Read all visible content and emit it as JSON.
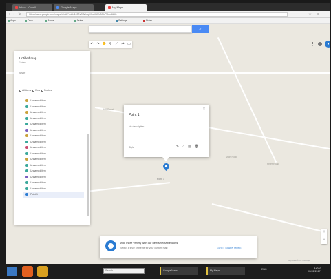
{
  "browser": {
    "tabs": [
      {
        "label": "Inbox - Gmail"
      },
      {
        "label": "Google Maps"
      },
      {
        "label": "My Maps"
      }
    ],
    "url": "https://www.google.com/maps/d/edit?mid=1z0ZsC4Wxq9KpuJ0fZq0GbPRmn6&ll=",
    "bookmarks": [
      "Apps",
      "Docs",
      "Maps",
      "Drive",
      "Settings",
      "Notes"
    ]
  },
  "map": {
    "search_placeholder": "",
    "search_icon": "search-icon",
    "road_labels": [
      "Main Road",
      "River Road",
      "Hill Street"
    ],
    "attribution": "Map data ©2017 Google"
  },
  "panel": {
    "title": "Untitled map",
    "subtitle": "1 view",
    "share_label": "Share",
    "layer_heading": [
      "All items",
      "Pins",
      "Routes"
    ],
    "items": [
      {
        "label": "Unnamed item",
        "color": "#c9a13a"
      },
      {
        "label": "Unnamed item",
        "color": "#3aa89b"
      },
      {
        "label": "Unnamed item",
        "color": "#c9a13a"
      },
      {
        "label": "Unnamed item",
        "color": "#3aa89b"
      },
      {
        "label": "Unnamed item",
        "color": "#3aa89b"
      },
      {
        "label": "Unnamed item",
        "color": "#7b5dc0"
      },
      {
        "label": "Unnamed item",
        "color": "#c9a13a"
      },
      {
        "label": "Unnamed item",
        "color": "#3aa89b"
      },
      {
        "label": "Unnamed item",
        "color": "#c94a6e"
      },
      {
        "label": "Unnamed item",
        "color": "#3aa89b"
      },
      {
        "label": "Unnamed item",
        "color": "#c9a13a"
      },
      {
        "label": "Unnamed item",
        "color": "#3aa89b"
      },
      {
        "label": "Unnamed item",
        "color": "#3aa89b"
      },
      {
        "label": "Unnamed item",
        "color": "#7b5dc0"
      },
      {
        "label": "Unnamed item",
        "color": "#3aa89b"
      },
      {
        "label": "Unnamed item",
        "color": "#3aa89b"
      },
      {
        "label": "Point 1",
        "color": "#2a7bd2",
        "selected": true
      }
    ]
  },
  "info_window": {
    "title": "Point 1",
    "body": "No description",
    "footer": "Style",
    "tools": [
      "✎",
      "⌂",
      "▤",
      "🗑"
    ]
  },
  "pin_label": "Point 1",
  "toast": {
    "title": "Add more variety with our new selectable icons",
    "body": "Select a style or theme for your custom map",
    "actions": "GOT IT   LEARN MORE"
  },
  "taskbar": {
    "search_text": "Search",
    "tasks": [
      "Google Maps",
      "My Maps"
    ],
    "tray": "ENG",
    "time": "12:00",
    "date": "01/01/2017"
  },
  "colors": {
    "accent": "#4a8af4",
    "map_bg": "#ebe8e0"
  }
}
